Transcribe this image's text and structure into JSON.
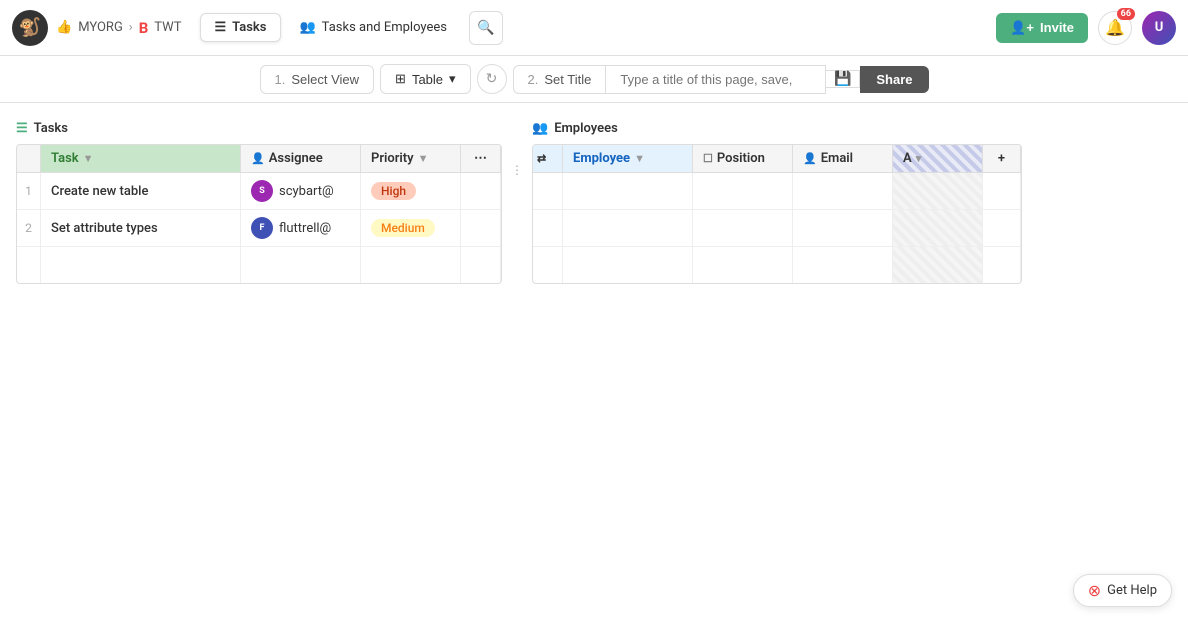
{
  "nav": {
    "logo_char": "🐒",
    "org_name": "MYORG",
    "project_name": "TWT",
    "tabs": [
      {
        "label": "Tasks",
        "active": true,
        "icon": "☰"
      },
      {
        "label": "Tasks and Employees",
        "active": false,
        "icon": "👥"
      }
    ],
    "search_placeholder": "",
    "invite_label": "Invite",
    "notification_count": "66"
  },
  "toolbar": {
    "select_view_label": "Select View",
    "select_view_num": "1.",
    "table_label": "Table",
    "set_title_label": "Set Title",
    "set_title_num": "2.",
    "title_placeholder": "Type a title of this page, save,",
    "share_label": "Share"
  },
  "tasks_table": {
    "section_label": "Tasks",
    "columns": [
      {
        "id": "task",
        "label": "Task",
        "type_icon": "▼"
      },
      {
        "id": "assignee",
        "label": "Assignee",
        "type_icon": "👤"
      },
      {
        "id": "priority",
        "label": "Priority",
        "type_icon": "▼"
      },
      {
        "id": "more",
        "label": "⋯"
      }
    ],
    "rows": [
      {
        "num": "1",
        "task": "Create new table",
        "assignee": "scybart@",
        "priority": "High",
        "priority_level": "high"
      },
      {
        "num": "2",
        "task": "Set attribute types",
        "assignee": "fluttrell@",
        "priority": "Medium",
        "priority_level": "medium"
      }
    ]
  },
  "employees_table": {
    "section_label": "Employees",
    "columns": [
      {
        "id": "employee",
        "label": "Employee",
        "type_icon": "▼"
      },
      {
        "id": "position",
        "label": "Position",
        "type_icon": "☐"
      },
      {
        "id": "email",
        "label": "Email",
        "type_icon": "👤"
      },
      {
        "id": "extra",
        "label": "A"
      },
      {
        "id": "add",
        "label": "+"
      }
    ],
    "rows": [
      {
        "employee": "",
        "position": "",
        "email": "",
        "extra": ""
      },
      {
        "employee": "",
        "position": "",
        "email": "",
        "extra": ""
      }
    ]
  },
  "get_help_label": "Get Help",
  "icons": {
    "tasks": "☰",
    "employees": "👥",
    "search": "🔍",
    "table": "⊞",
    "refresh": "↻",
    "save": "💾",
    "chevron": "▾",
    "sort": "⇅"
  }
}
